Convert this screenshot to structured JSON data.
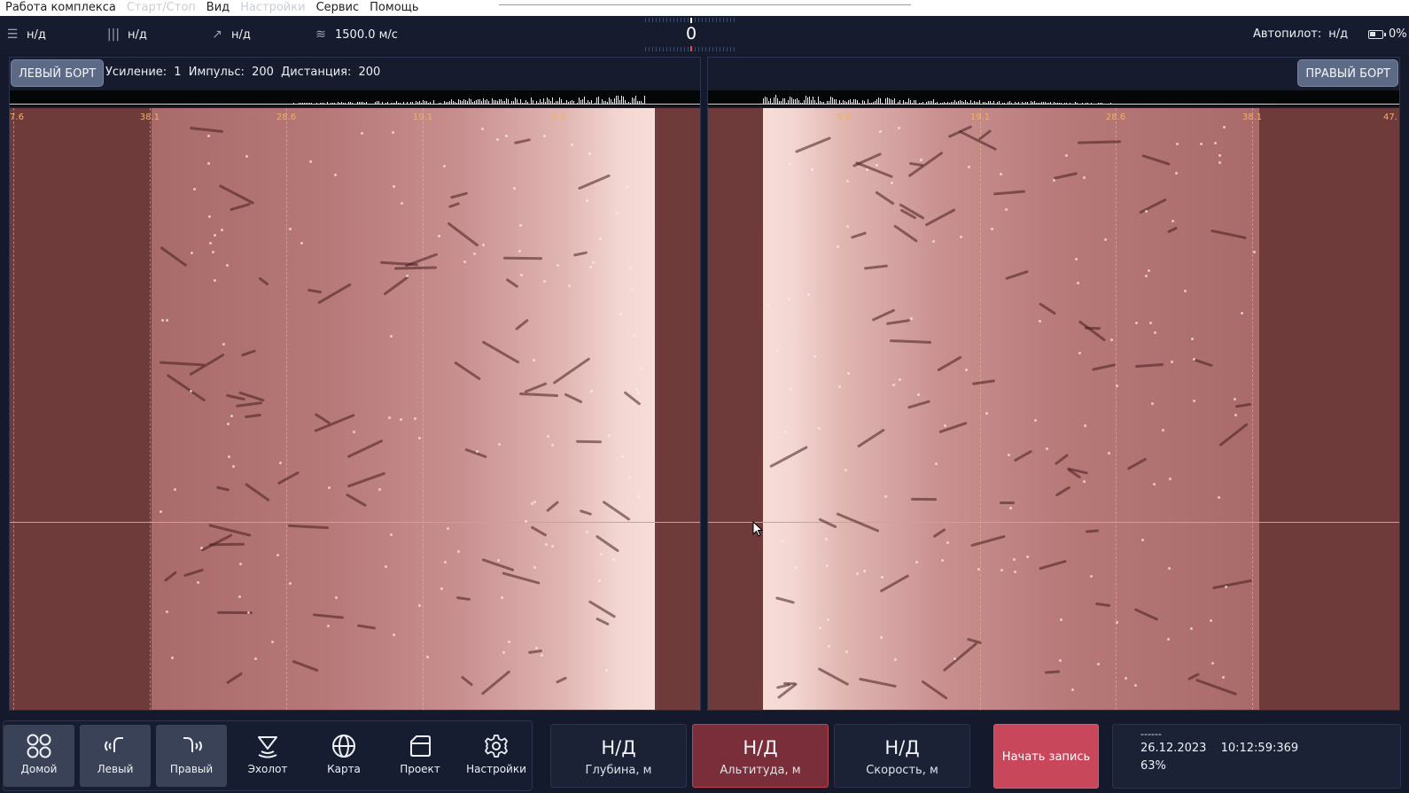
{
  "menu": {
    "items": [
      {
        "label": "Работа комплекса",
        "enabled": true
      },
      {
        "label": "Старт/Стоп",
        "enabled": false
      },
      {
        "label": "Вид",
        "enabled": true
      },
      {
        "label": "Настройки",
        "enabled": false
      },
      {
        "label": "Сервис",
        "enabled": true
      },
      {
        "label": "Помощь",
        "enabled": true
      }
    ]
  },
  "status": {
    "menu_icon": "hamburger-icon",
    "item1": "н/д",
    "signal_icon": "signal-bars-icon",
    "item2": "н/д",
    "course_icon": "arrow-up-right-icon",
    "item3": "н/д",
    "sound_icon": "waves-icon",
    "sound_speed": "1500.0 м/с",
    "heading": "0",
    "autopilot_label": "Автопилот:",
    "autopilot_value": "н/д",
    "battery": "0%"
  },
  "left_panel": {
    "button": "ЛЕВЫЙ БОРТ",
    "gain_label": "Усиление:",
    "gain": "1",
    "pulse_label": "Импульс:",
    "pulse": "200",
    "distance_label": "Дистанция:",
    "distance": "200",
    "range_labels": [
      "7.6",
      "38.1",
      "28.6",
      "19.1",
      "9.6"
    ]
  },
  "right_panel": {
    "button": "ПРАВЫЙ БОРТ",
    "range_labels": [
      "9.6",
      "19.1",
      "28.6",
      "38.1",
      "47."
    ]
  },
  "toolbar": {
    "nav": [
      {
        "label": "Домой",
        "icon": "grid-home-icon",
        "active": true
      },
      {
        "label": "Левый",
        "icon": "left-sonar-icon",
        "active": true
      },
      {
        "label": "Правый",
        "icon": "right-sonar-icon",
        "active": true
      },
      {
        "label": "Эхолот",
        "icon": "echosounder-icon",
        "active": false
      },
      {
        "label": "Карта",
        "icon": "globe-icon",
        "active": false
      },
      {
        "label": "Проект",
        "icon": "folder-icon",
        "active": false
      },
      {
        "label": "Настройки",
        "icon": "gear-icon",
        "active": false
      }
    ],
    "metrics": [
      {
        "value": "Н/Д",
        "label": "Глубина, м",
        "alert": false
      },
      {
        "value": "Н/Д",
        "label": "Альтитуда, м",
        "alert": true
      },
      {
        "value": "Н/Д",
        "label": "Скорость, м",
        "alert": false
      }
    ],
    "record_button": "Начать запись",
    "info": {
      "dashes": "------",
      "date": "26.12.2023",
      "time": "10:12:59:369",
      "percent": "63%"
    }
  },
  "colors": {
    "background": "#141a2b",
    "sonar_shadow": "#6e3a3a",
    "sonar_bright": "#f3d6d2",
    "cursor_line": "#ff8a8a",
    "range_label": "#f0b070",
    "record_button": "#c8475a",
    "alert_metric": "#7a2e3a"
  }
}
